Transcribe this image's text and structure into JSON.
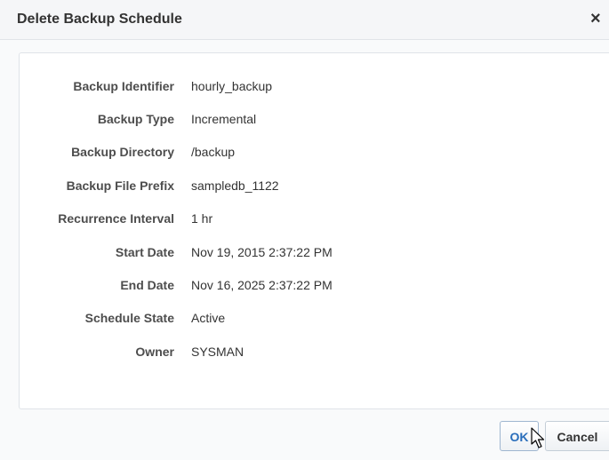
{
  "dialog": {
    "title": "Delete Backup Schedule",
    "close_glyph": "×"
  },
  "details": [
    {
      "label": "Backup Identifier",
      "value": "hourly_backup"
    },
    {
      "label": "Backup Type",
      "value": "Incremental"
    },
    {
      "label": "Backup Directory",
      "value": "/backup"
    },
    {
      "label": "Backup File Prefix",
      "value": "sampledb_1122"
    },
    {
      "label": "Recurrence Interval",
      "value": "1 hr"
    },
    {
      "label": "Start Date",
      "value": "Nov 19, 2015 2:37:22 PM"
    },
    {
      "label": "End Date",
      "value": "Nov 16, 2025 2:37:22 PM"
    },
    {
      "label": "Schedule State",
      "value": "Active"
    },
    {
      "label": "Owner",
      "value": "SYSMAN"
    }
  ],
  "buttons": {
    "ok_label": "OK",
    "cancel_label": "Cancel"
  },
  "icons": {
    "close": "close-icon",
    "cursor": "mouse-pointer-icon"
  },
  "colors": {
    "title_text": "#333333",
    "label_text": "#4d4d4d",
    "ok_text": "#2a6ebb",
    "panel_border": "#dfe3e8",
    "background": "#f9fafb"
  }
}
